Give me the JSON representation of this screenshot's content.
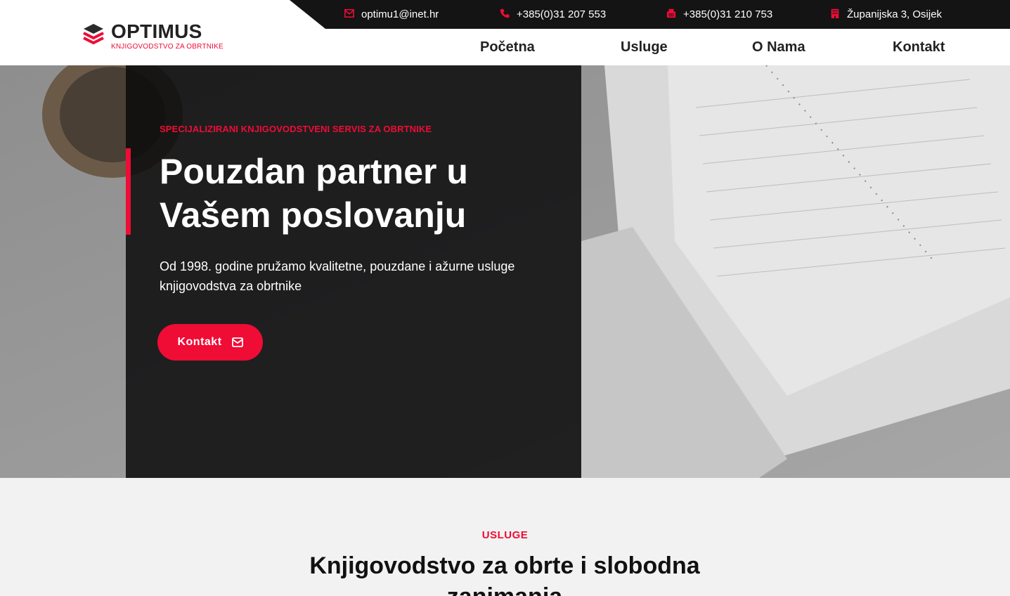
{
  "header": {
    "logo_title": "OPTIMUS",
    "logo_subtitle": "KNJIGOVODSTVO ZA OBRTNIKE",
    "contacts": {
      "email": "optimu1@inet.hr",
      "phone": "+385(0)31 207 553",
      "fax": "+385(0)31 210 753",
      "address": "Županijska 3, Osijek"
    },
    "nav": [
      "Početna",
      "Usluge",
      "O Nama",
      "Kontakt"
    ]
  },
  "hero": {
    "eyebrow": "SPECIJALIZIRANI KNJIGOVODSTVENI SERVIS ZA OBRTNIKE",
    "title_line1": "Pouzdan partner u",
    "title_line2": "Vašem poslovanju",
    "description": "Od 1998. godine pružamo kvalitetne, pouzdane i ažurne usluge knjigovodstva za obrtnike",
    "button_label": "Kontakt"
  },
  "services": {
    "eyebrow": "USLUGE",
    "title": "Knjigovodstvo za obrte i slobodna zanimanja"
  },
  "colors": {
    "accent": "#ef0c35",
    "topbar": "#141414",
    "dark_panel": "#0a0a0c"
  },
  "icons": {
    "email": "envelope-icon",
    "phone": "phone-icon",
    "fax": "fax-icon",
    "address": "building-icon",
    "button": "envelope-icon"
  }
}
